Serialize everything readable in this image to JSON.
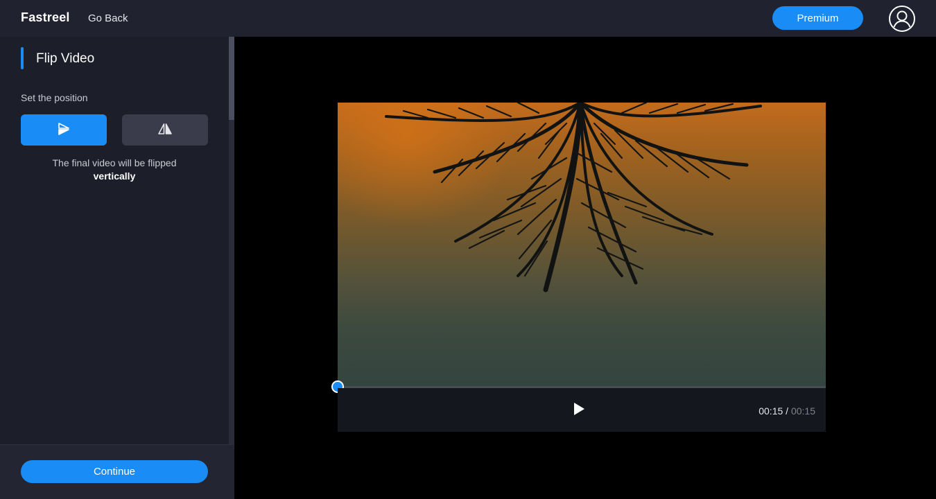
{
  "header": {
    "brand": "Fastreel",
    "go_back": "Go Back",
    "premium": "Premium"
  },
  "sidebar": {
    "section_title": "Flip Video",
    "position_label": "Set the position",
    "flip_options": [
      {
        "name": "flip-vertical",
        "icon": "flip-vertical-icon",
        "selected": true
      },
      {
        "name": "flip-horizontal",
        "icon": "flip-horizontal-icon",
        "selected": false
      }
    ],
    "description": "The final video will be flipped",
    "description_emphasis": "vertically",
    "continue": "Continue"
  },
  "player": {
    "current_time": "00:15",
    "separator": " / ",
    "total_time": "00:15",
    "progress_fraction": 0.0
  },
  "colors": {
    "accent": "#1a8cf5",
    "topbar": "#20222f",
    "sidebar": "#1c1e2a"
  }
}
